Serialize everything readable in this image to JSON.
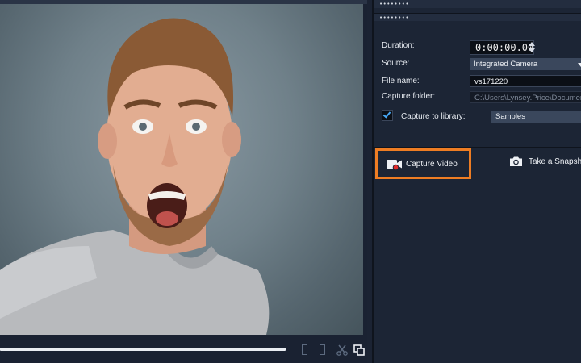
{
  "options": {
    "grip_top": "••••••••",
    "grip_second": "••••••••",
    "duration": {
      "label": "Duration:",
      "value": "0:00:00.00"
    },
    "source": {
      "label": "Source:",
      "value": "Integrated Camera"
    },
    "file_name": {
      "label": "File name:",
      "value": "vs171220"
    },
    "capture_folder": {
      "label": "Capture folder:",
      "value": "C:\\Users\\Lynsey.Price\\Documents"
    },
    "capture_to_library": {
      "label": "Capture to library:",
      "checked": true,
      "value": "Samples"
    },
    "capture_video_label": "Capture Video",
    "snapshot_label": "Take a Snapshot"
  },
  "colors": {
    "highlight": "#ee7d23",
    "record_dot": "#e02b2b",
    "checkbox_tick": "#47a7f5"
  },
  "icons": [
    "mark-in-icon",
    "mark-out-icon",
    "scissors-icon",
    "copy-icon",
    "video-camera-icon",
    "camera-icon"
  ]
}
